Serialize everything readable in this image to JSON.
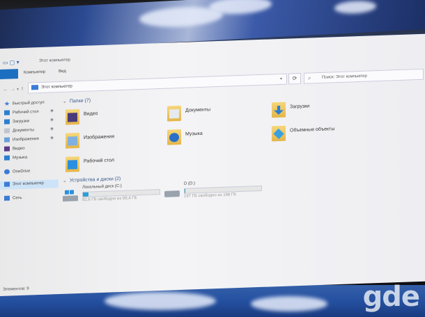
{
  "window": {
    "title": "Этот компьютер"
  },
  "ribbon": {
    "file_tab": "",
    "tabs": [
      "Компьютер",
      "Вид"
    ]
  },
  "address": {
    "path": "Этот компьютер",
    "search_placeholder": "Поиск: Этот компьютер"
  },
  "sidebar": {
    "items": [
      {
        "label": "Быстрый доступ",
        "icon": "star-icon",
        "pinned": false
      },
      {
        "label": "Рабочий стол",
        "icon": "desktop-icon",
        "pinned": true
      },
      {
        "label": "Загрузки",
        "icon": "download-icon",
        "pinned": true
      },
      {
        "label": "Документы",
        "icon": "document-icon",
        "pinned": true
      },
      {
        "label": "Изображения",
        "icon": "image-icon",
        "pinned": true
      },
      {
        "label": "Видео",
        "icon": "video-icon",
        "pinned": false
      },
      {
        "label": "Музыка",
        "icon": "music-icon",
        "pinned": false
      },
      {
        "label": "OneDrive",
        "icon": "cloud-icon",
        "pinned": false
      },
      {
        "label": "Этот компьютер",
        "icon": "computer-icon",
        "pinned": false,
        "selected": true
      },
      {
        "label": "Сеть",
        "icon": "network-icon",
        "pinned": false
      }
    ]
  },
  "folders_group": {
    "title": "Папки (7)"
  },
  "folders": [
    {
      "label": "Видео",
      "icon": "video-icon"
    },
    {
      "label": "Документы",
      "icon": "document-icon"
    },
    {
      "label": "Загрузки",
      "icon": "download-icon"
    },
    {
      "label": "Изображения",
      "icon": "image-icon"
    },
    {
      "label": "Музыка",
      "icon": "music-icon"
    },
    {
      "label": "Объемные объекты",
      "icon": "3d-objects-icon"
    },
    {
      "label": "Рабочий стол",
      "icon": "desktop-icon"
    }
  ],
  "drives_group": {
    "title": "Устройства и диски (2)"
  },
  "drives": [
    {
      "label": "Локальный диск (C:)",
      "free_text": "92,6 ГБ свободно из 99,4 ГБ",
      "used_fraction": 0.07,
      "icon": "windows-drive-icon"
    },
    {
      "label": "D (D:)",
      "free_text": "197 ГБ свободно из 198 ГБ",
      "used_fraction": 0.005,
      "icon": "hard-drive-icon"
    }
  ],
  "status": {
    "text": "Элементов: 9"
  },
  "watermark": "gde",
  "colors": {
    "accent": "#1c6fc0",
    "drive_fill": "#2a9fd8",
    "folder": "#e4b64a"
  }
}
